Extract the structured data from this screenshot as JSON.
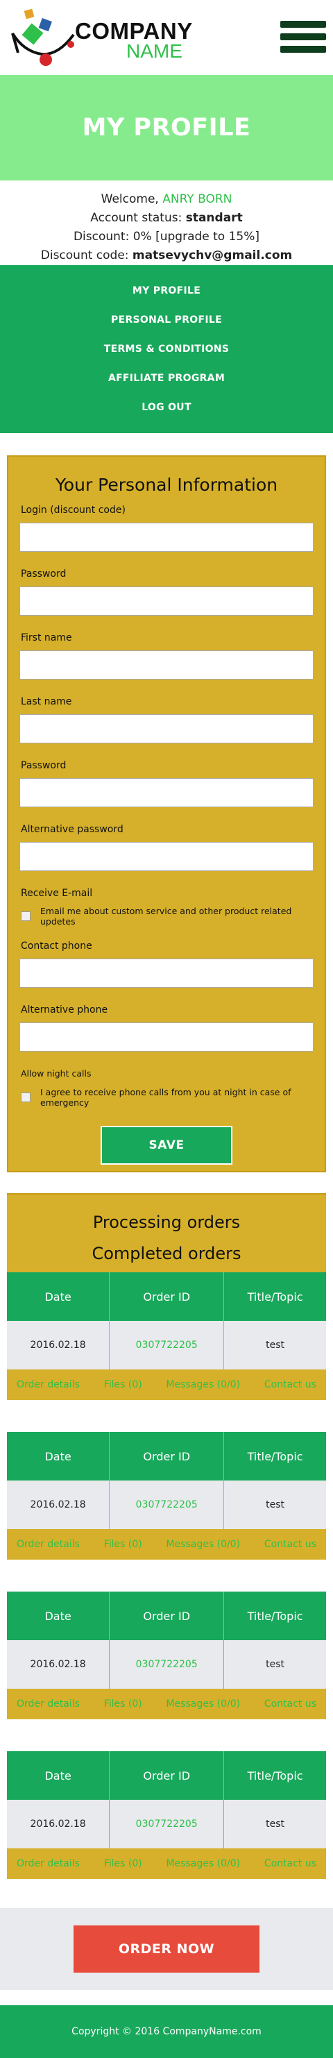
{
  "header": {
    "logo_line1": "COMPANY",
    "logo_line2": "NAME",
    "menu_icon": "hamburger-icon"
  },
  "banner": {
    "title": "MY PROFILE"
  },
  "account": {
    "welcome_prefix": "Welcome,",
    "user_name": "ANRY BORN",
    "status_label": "Account status:",
    "status_value": "standart",
    "discount_text": "Discount: 0% [upgrade to 15%]",
    "code_label": "Discount code:",
    "code_value": "matsevychv@gmail.com"
  },
  "nav": {
    "items": [
      "MY PROFILE",
      "PERSONAL PROFILE",
      "TERMS & CONDITIONS",
      "AFFILIATE PROGRAM",
      "LOG OUT"
    ]
  },
  "form": {
    "title": "Your Personal Information",
    "login_label": "Login (discount code)",
    "password_label": "Password",
    "first_name_label": "First name",
    "last_name_label": "Last name",
    "password2_label": "Password",
    "alt_password_label": "Alternative password",
    "receive_email_label": "Receive E-mail",
    "email_check_text": "Email me about custom service and other product related updetes",
    "contact_phone_label": "Contact phone",
    "alt_phone_label": "Alternative phone",
    "night_calls_label": "Allow night calls",
    "night_check_text": "I agree to receive phone calls from you at night in case of emergency",
    "save_label": "SAVE"
  },
  "orders": {
    "tab_processing": "Processing orders",
    "tab_completed": "Completed orders",
    "columns": [
      "Date",
      "Order ID",
      "Title/Topic"
    ],
    "links": [
      "Order details",
      "Files (0)",
      "Messages (0/0)",
      "Contact us"
    ],
    "rows": [
      {
        "date": "2016.02.18",
        "id": "0307722205",
        "title": "test"
      },
      {
        "date": "2016.02.18",
        "id": "0307722205",
        "title": "test"
      },
      {
        "date": "2016.02.18",
        "id": "0307722205",
        "title": "test"
      },
      {
        "date": "2016.02.18",
        "id": "0307722205",
        "title": "test"
      }
    ]
  },
  "order_now": {
    "label": "ORDER NOW"
  },
  "footer": {
    "text": "Copyright © 2016 CompanyName.com"
  },
  "colors": {
    "accent_green": "#18a85b",
    "light_green": "#86eb8d",
    "link_green": "#2ec04a",
    "panel_gold": "#d6b02a",
    "order_red": "#e74b3c"
  }
}
